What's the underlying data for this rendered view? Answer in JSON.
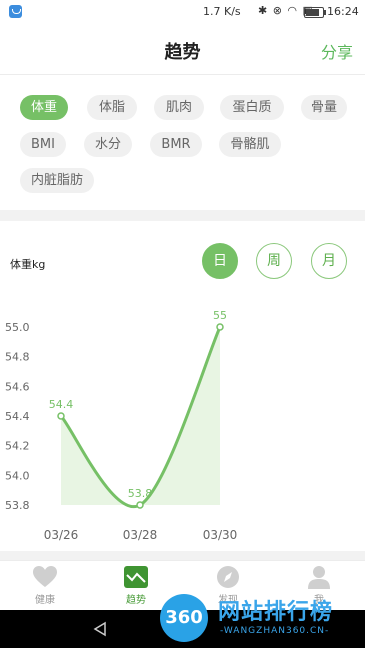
{
  "status_bar": {
    "speed": "1.7 K/s",
    "icons": "✱ ⊗ ◠ ▣",
    "time": "16:24"
  },
  "header": {
    "title": "趋势",
    "share_label": "分享"
  },
  "tags": {
    "rows": [
      [
        {
          "label": "体重",
          "active": true
        },
        {
          "label": "体脂"
        },
        {
          "label": "肌肉"
        },
        {
          "label": "蛋白质"
        },
        {
          "label": "骨量"
        }
      ],
      [
        {
          "label": "BMI"
        },
        {
          "label": "水分"
        },
        {
          "label": "BMR"
        },
        {
          "label": "骨骼肌"
        }
      ],
      [
        {
          "label": "内脏脂肪"
        }
      ]
    ]
  },
  "chart_section": {
    "unit_label": "体重kg",
    "period_buttons": [
      {
        "label": "日",
        "active": true
      },
      {
        "label": "周"
      },
      {
        "label": "月"
      }
    ]
  },
  "chart_data": {
    "type": "line",
    "x": [
      "03/26",
      "03/28",
      "03/30"
    ],
    "values": [
      54.4,
      53.8,
      55.0
    ],
    "data_labels": [
      "54.4",
      "53.8",
      "55"
    ],
    "yticks": [
      "55.0",
      "54.8",
      "54.6",
      "54.4",
      "54.2",
      "54.0",
      "53.8"
    ],
    "ylim": [
      53.8,
      55.0
    ],
    "line_color": "#76c066",
    "fill_color": "#e8f5e3"
  },
  "bottom_nav": [
    {
      "label": "健康",
      "icon": "heart-icon"
    },
    {
      "label": "趋势",
      "icon": "trend-icon",
      "active": true
    },
    {
      "label": "发现",
      "icon": "compass-icon"
    },
    {
      "label": "我",
      "icon": "person-icon"
    }
  ],
  "watermark": {
    "badge": "360",
    "text": "网站排行榜",
    "url": "-WANGZHAN360.CN-"
  }
}
